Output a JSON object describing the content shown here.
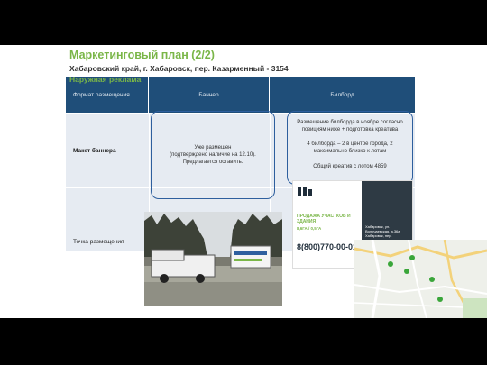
{
  "header": {
    "title": "Маркетинговый план (2/2)",
    "subtitle": "Хабаровский край, г. Хабаровск, пер. Казарменный - 3154",
    "section": "Наружная реклама"
  },
  "table": {
    "headers": [
      "Формат размещения",
      "Баннер",
      "Билборд"
    ],
    "rows": [
      {
        "label": "Макет баннера"
      },
      {
        "label": "Точка размещения"
      }
    ],
    "banner_text": "Уже размещен\n(подтверждено наличие на 12.10).\nПредлагается оставить.",
    "billboard_text": "Размещение билборда в ноябре согласно позициям ниже + подготовка креатива\n\n4 билборда – 2 в центре города, 2 максимально близко к лотам\n\nОбщий креатив с лотом 4859"
  },
  "billboard_ad": {
    "headline": "ПРОДАЖА УЧАСТКОВ И ЗДАНИЯ",
    "area": "8,6ГА / 0,5ГА",
    "phone": "8(800)770-00-01",
    "address": "Хабаровск, ул. Волочаевская, д.36а\nХабаровск, пер. Казарменный"
  },
  "photo_sign_text": "ПРОДАЖА УЧАСТКОВ И ЗДАНИЯ",
  "colors": {
    "accent_green": "#7ab648",
    "header_blue": "#1f4e79",
    "cell_bg": "#e6ebf2",
    "outline_blue": "#2e5f9e"
  }
}
